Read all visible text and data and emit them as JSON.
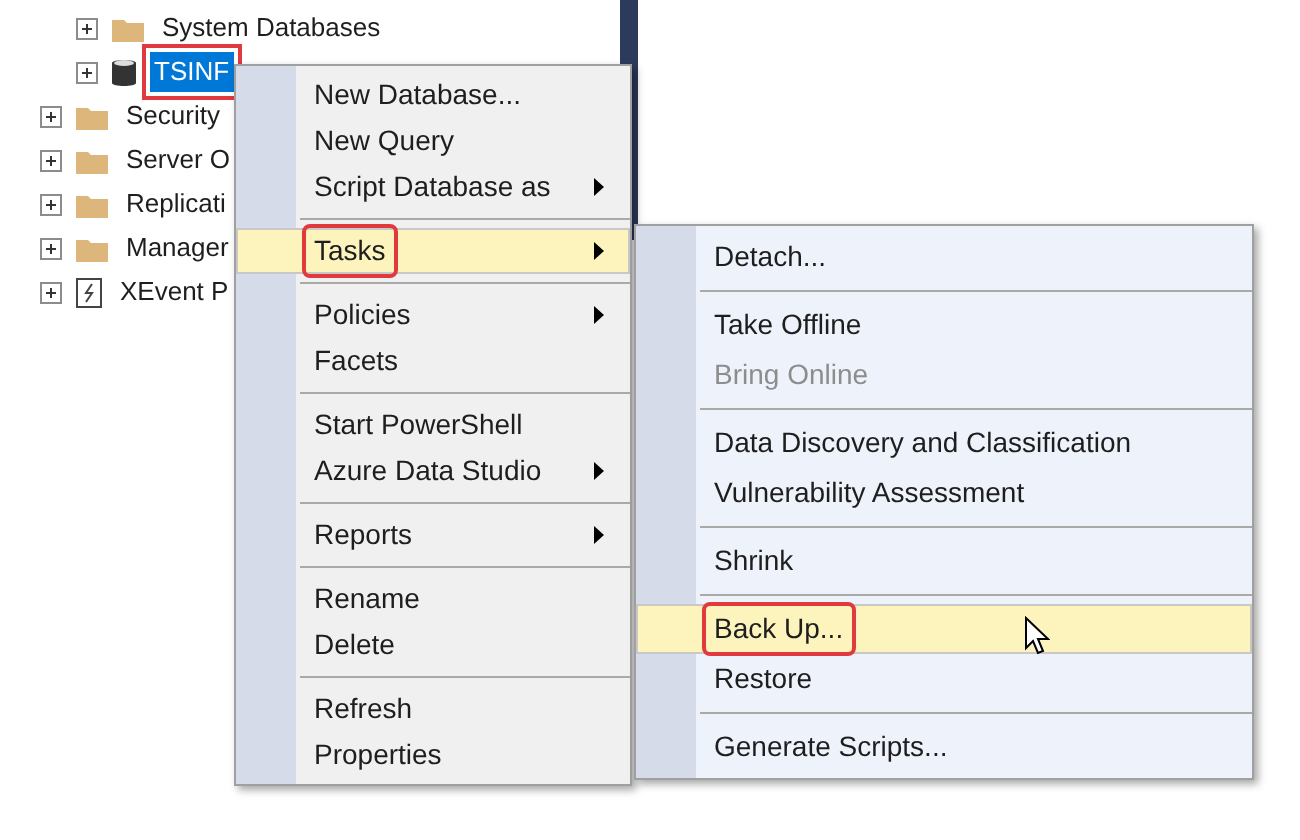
{
  "databases_children": [
    {
      "kind": "folder",
      "label": "System Databases",
      "selected": false,
      "annotated": false
    },
    {
      "kind": "database",
      "label": "TSINF",
      "selected": true,
      "annotated": true
    }
  ],
  "server_children": [
    {
      "kind": "folder",
      "label": "Security",
      "selected": false,
      "annotated": false
    },
    {
      "kind": "folder",
      "label": "Server O",
      "selected": false,
      "annotated": false
    },
    {
      "kind": "folder",
      "label": "Replicati",
      "selected": false,
      "annotated": false
    },
    {
      "kind": "folder",
      "label": "Manager",
      "selected": false,
      "annotated": false
    },
    {
      "kind": "xevent",
      "label": "XEvent P",
      "selected": false,
      "annotated": false
    }
  ],
  "context_menu": {
    "items": [
      {
        "kind": "item",
        "label": "New Database...",
        "submenu": false,
        "selected": false,
        "annotated": false
      },
      {
        "kind": "item",
        "label": "New Query",
        "submenu": false,
        "selected": false,
        "annotated": false
      },
      {
        "kind": "item",
        "label": "Script Database as",
        "submenu": true,
        "selected": false,
        "annotated": false
      },
      {
        "kind": "separator"
      },
      {
        "kind": "item",
        "label": "Tasks",
        "submenu": true,
        "selected": true,
        "annotated": true
      },
      {
        "kind": "separator"
      },
      {
        "kind": "item",
        "label": "Policies",
        "submenu": true,
        "selected": false,
        "annotated": false
      },
      {
        "kind": "item",
        "label": "Facets",
        "submenu": false,
        "selected": false,
        "annotated": false
      },
      {
        "kind": "separator"
      },
      {
        "kind": "item",
        "label": "Start PowerShell",
        "submenu": false,
        "selected": false,
        "annotated": false
      },
      {
        "kind": "item",
        "label": "Azure Data Studio",
        "submenu": true,
        "selected": false,
        "annotated": false
      },
      {
        "kind": "separator"
      },
      {
        "kind": "item",
        "label": "Reports",
        "submenu": true,
        "selected": false,
        "annotated": false
      },
      {
        "kind": "separator"
      },
      {
        "kind": "item",
        "label": "Rename",
        "submenu": false,
        "selected": false,
        "annotated": false
      },
      {
        "kind": "item",
        "label": "Delete",
        "submenu": false,
        "selected": false,
        "annotated": false
      },
      {
        "kind": "separator"
      },
      {
        "kind": "item",
        "label": "Refresh",
        "submenu": false,
        "selected": false,
        "annotated": false
      },
      {
        "kind": "item",
        "label": "Properties",
        "submenu": false,
        "selected": false,
        "annotated": false
      }
    ]
  },
  "tasks_submenu": {
    "items": [
      {
        "kind": "item",
        "label": "Detach...",
        "disabled": false,
        "selected": false,
        "annotated": false
      },
      {
        "kind": "separator"
      },
      {
        "kind": "item",
        "label": "Take Offline",
        "disabled": false,
        "selected": false,
        "annotated": false
      },
      {
        "kind": "item",
        "label": "Bring Online",
        "disabled": true,
        "selected": false,
        "annotated": false
      },
      {
        "kind": "separator"
      },
      {
        "kind": "item",
        "label": "Data Discovery and Classification",
        "disabled": false,
        "selected": false,
        "annotated": false
      },
      {
        "kind": "item",
        "label": "Vulnerability Assessment",
        "disabled": false,
        "selected": false,
        "annotated": false
      },
      {
        "kind": "separator"
      },
      {
        "kind": "item",
        "label": "Shrink",
        "disabled": false,
        "selected": false,
        "annotated": false
      },
      {
        "kind": "separator"
      },
      {
        "kind": "item",
        "label": "Back Up...",
        "disabled": false,
        "selected": true,
        "annotated": true
      },
      {
        "kind": "item",
        "label": "Restore",
        "disabled": false,
        "selected": false,
        "annotated": false
      },
      {
        "kind": "separator"
      },
      {
        "kind": "item",
        "label": "Generate Scripts...",
        "disabled": false,
        "selected": false,
        "annotated": false
      }
    ]
  }
}
